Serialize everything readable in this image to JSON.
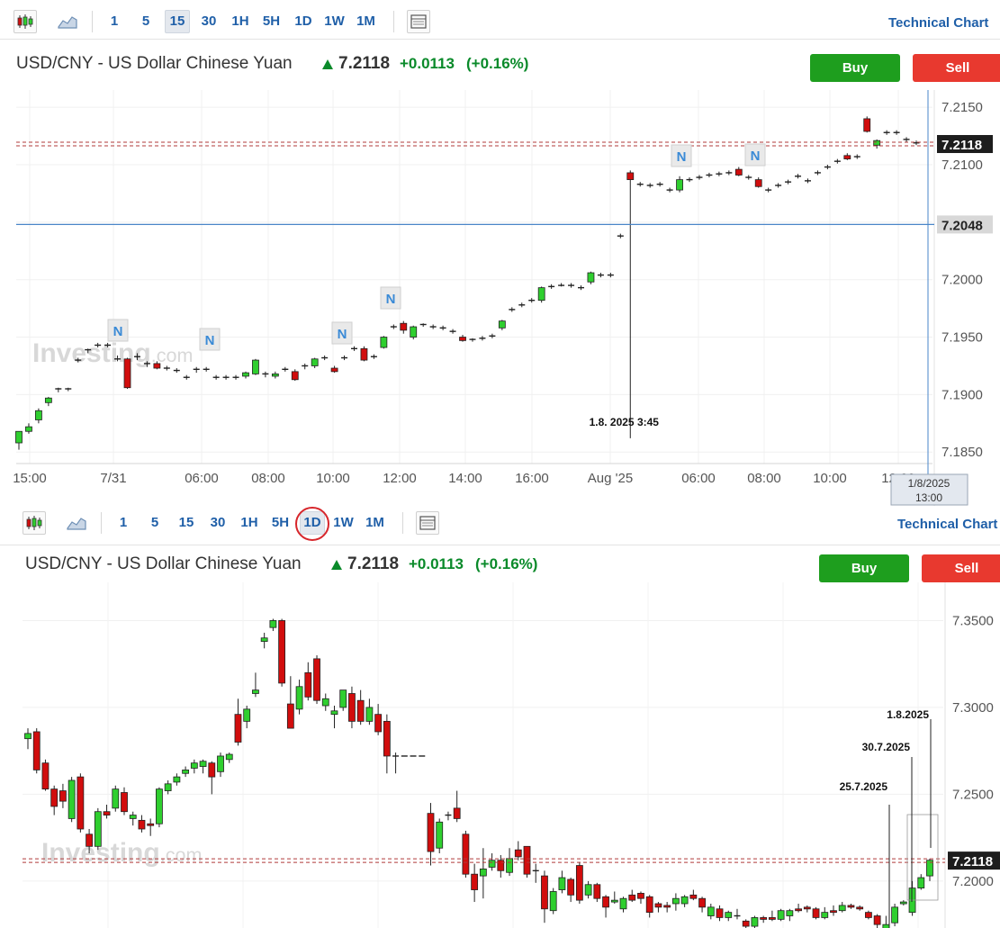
{
  "colors": {
    "up": "#2fcf2f",
    "down": "#d10d0d",
    "link": "#1f5fa8",
    "buy": "#1e9e1e",
    "sell": "#e8392f",
    "price_line": "#b03a3a",
    "crosshair": "#4a86c8",
    "change": "#0a8a2a"
  },
  "toolbar": {
    "timeframes": [
      "1",
      "5",
      "15",
      "30",
      "1H",
      "5H",
      "1D",
      "1W",
      "1M"
    ],
    "technical_chart": "Technical Chart",
    "icons": [
      "candlestick-icon",
      "area-chart-icon",
      "layout-icon"
    ]
  },
  "quote": {
    "name": "USD/CNY - US Dollar Chinese Yuan",
    "price": "7.2118",
    "change": "+0.0113",
    "change_pct": "(+0.16%)",
    "direction_icon": "up-arrow-icon"
  },
  "buttons": {
    "buy": "Buy",
    "sell": "Sell"
  },
  "watermark": {
    "brand": "Investing",
    "suffix": ".com"
  },
  "panel_top": {
    "active_timeframe": "15",
    "current_price_label": "7.2118",
    "crosshair_price_label": "7.2048",
    "crosshair_time_label_line1": "1/8/2025",
    "crosshair_time_label_line2": "13:00",
    "event_annotation": "1.8. 2025 3:45",
    "news_marker": "N"
  },
  "panel_bottom": {
    "active_timeframe": "1D",
    "current_price_label": "7.2118",
    "annotations": [
      "25.7.2025",
      "30.7.2025",
      "1.8.2025"
    ]
  },
  "chart_data": [
    {
      "type": "candlestick",
      "timeframe": "15 minutes",
      "x_tick_labels": [
        "15:00",
        "7/31",
        "06:00",
        "08:00",
        "10:00",
        "12:00",
        "14:00",
        "16:00",
        "Aug '25",
        "06:00",
        "08:00",
        "10:00",
        "12:00"
      ],
      "y_tick_labels": [
        "7.2150",
        "7.2100",
        "7.2050",
        "7.2000",
        "7.1950",
        "7.1900",
        "7.1850"
      ],
      "ylim": [
        7.184,
        7.2165
      ],
      "last_price": 7.2118,
      "crosshair_price": 7.2048,
      "annotation": "1.8. 2025 3:45",
      "candles": [
        [
          7.1858,
          7.1868,
          7.1852,
          7.1868
        ],
        [
          7.1868,
          7.1875,
          7.1866,
          7.1872
        ],
        [
          7.1878,
          7.1888,
          7.1875,
          7.1886
        ],
        [
          7.1893,
          7.1898,
          7.189,
          7.1897
        ],
        [
          7.1904,
          7.1906,
          7.1902,
          7.1905
        ],
        [
          7.1905,
          7.1906,
          7.1903,
          7.1905
        ],
        [
          7.193,
          7.1932,
          7.1928,
          7.193
        ],
        [
          7.1938,
          7.194,
          7.1936,
          7.1939
        ],
        [
          7.1943,
          7.1945,
          7.1941,
          7.1943
        ],
        [
          7.1943,
          7.1945,
          7.1941,
          7.1943
        ],
        [
          7.1931,
          7.1934,
          7.1929,
          7.1931
        ],
        [
          7.1931,
          7.1932,
          7.1905,
          7.1906
        ],
        [
          7.1932,
          7.1936,
          7.193,
          7.1933
        ],
        [
          7.1927,
          7.1929,
          7.1924,
          7.1927
        ],
        [
          7.1927,
          7.1929,
          7.1922,
          7.1923
        ],
        [
          7.1923,
          7.1925,
          7.1921,
          7.1923
        ],
        [
          7.1921,
          7.1923,
          7.1919,
          7.192
        ],
        [
          7.1915,
          7.1917,
          7.1913,
          7.1915
        ],
        [
          7.1921,
          7.1924,
          7.1919,
          7.1922
        ],
        [
          7.1922,
          7.1924,
          7.192,
          7.1922
        ],
        [
          7.1915,
          7.1917,
          7.1913,
          7.1915
        ],
        [
          7.1915,
          7.1917,
          7.1913,
          7.1915
        ],
        [
          7.1915,
          7.1917,
          7.1913,
          7.1914
        ],
        [
          7.1916,
          7.192,
          7.1914,
          7.1919
        ],
        [
          7.1918,
          7.1931,
          7.1917,
          7.193
        ],
        [
          7.1918,
          7.192,
          7.1915,
          7.1918
        ],
        [
          7.1916,
          7.192,
          7.1914,
          7.1918
        ],
        [
          7.1922,
          7.1924,
          7.192,
          7.1922
        ],
        [
          7.192,
          7.1922,
          7.1912,
          7.1913
        ],
        [
          7.1924,
          7.1927,
          7.1922,
          7.1925
        ],
        [
          7.1925,
          7.1932,
          7.1923,
          7.1931
        ],
        [
          7.1932,
          7.1934,
          7.193,
          7.1932
        ],
        [
          7.1923,
          7.1925,
          7.1919,
          7.192
        ],
        [
          7.1932,
          7.1934,
          7.193,
          7.1932
        ],
        [
          7.194,
          7.1942,
          7.1938,
          7.194
        ],
        [
          7.194,
          7.1942,
          7.1929,
          7.193
        ],
        [
          7.1933,
          7.1935,
          7.1931,
          7.1933
        ],
        [
          7.1941,
          7.1951,
          7.194,
          7.195
        ],
        [
          7.1959,
          7.1961,
          7.1957,
          7.1959
        ],
        [
          7.1962,
          7.1964,
          7.1953,
          7.1956
        ],
        [
          7.195,
          7.196,
          7.1948,
          7.1959
        ],
        [
          7.1961,
          7.1962,
          7.1959,
          7.1961
        ],
        [
          7.1959,
          7.1961,
          7.1957,
          7.1959
        ],
        [
          7.1958,
          7.196,
          7.1956,
          7.1958
        ],
        [
          7.1955,
          7.1957,
          7.1953,
          7.1955
        ],
        [
          7.195,
          7.1952,
          7.1946,
          7.1947
        ],
        [
          7.1948,
          7.1949,
          7.1946,
          7.1948
        ],
        [
          7.1949,
          7.1951,
          7.1947,
          7.1949
        ],
        [
          7.1951,
          7.1953,
          7.1949,
          7.1951
        ],
        [
          7.1958,
          7.1965,
          7.1956,
          7.1964
        ],
        [
          7.1974,
          7.1976,
          7.1972,
          7.1974
        ],
        [
          7.1978,
          7.198,
          7.1976,
          7.1978
        ],
        [
          7.1982,
          7.1984,
          7.198,
          7.1982
        ],
        [
          7.1982,
          7.1994,
          7.198,
          7.1993
        ],
        [
          7.1994,
          7.1996,
          7.1992,
          7.1994
        ],
        [
          7.1995,
          7.1997,
          7.1994,
          7.1995
        ],
        [
          7.1995,
          7.1997,
          7.1993,
          7.1994
        ],
        [
          7.1993,
          7.1995,
          7.1991,
          7.1993
        ],
        [
          7.1998,
          7.2007,
          7.1996,
          7.2006
        ],
        [
          7.2004,
          7.2006,
          7.2002,
          7.2004
        ],
        [
          7.2004,
          7.2006,
          7.2002,
          7.2004
        ],
        [
          7.2038,
          7.204,
          7.2036,
          7.2038
        ],
        [
          7.2093,
          7.2095,
          7.1862,
          7.2087
        ],
        [
          7.2083,
          7.2085,
          7.2081,
          7.2083
        ],
        [
          7.2082,
          7.2084,
          7.208,
          7.2082
        ],
        [
          7.2083,
          7.2085,
          7.2081,
          7.2083
        ],
        [
          7.2078,
          7.208,
          7.2076,
          7.2078
        ],
        [
          7.2078,
          7.209,
          7.2076,
          7.2087
        ],
        [
          7.2087,
          7.2089,
          7.2085,
          7.2087
        ],
        [
          7.2089,
          7.2091,
          7.2087,
          7.2089
        ],
        [
          7.2091,
          7.2093,
          7.2089,
          7.2091
        ],
        [
          7.2092,
          7.2094,
          7.209,
          7.2092
        ],
        [
          7.2093,
          7.2095,
          7.2091,
          7.2093
        ],
        [
          7.2096,
          7.2098,
          7.209,
          7.2091
        ],
        [
          7.2089,
          7.2091,
          7.2087,
          7.2089
        ],
        [
          7.2087,
          7.2089,
          7.208,
          7.2081
        ],
        [
          7.2078,
          7.208,
          7.2076,
          7.2077
        ],
        [
          7.2082,
          7.2084,
          7.208,
          7.2082
        ],
        [
          7.2085,
          7.2087,
          7.2083,
          7.2085
        ],
        [
          7.209,
          7.2092,
          7.2088,
          7.209
        ],
        [
          7.2086,
          7.2088,
          7.2084,
          7.2086
        ],
        [
          7.2093,
          7.2095,
          7.2091,
          7.2093
        ],
        [
          7.2098,
          7.21,
          7.2096,
          7.2098
        ],
        [
          7.2103,
          7.2105,
          7.2101,
          7.2103
        ],
        [
          7.2108,
          7.211,
          7.2104,
          7.2105
        ],
        [
          7.2107,
          7.2109,
          7.2105,
          7.2107
        ],
        [
          7.214,
          7.2142,
          7.2128,
          7.2129
        ],
        [
          7.2117,
          7.2122,
          7.2114,
          7.2121
        ],
        [
          7.2128,
          7.213,
          7.2126,
          7.2128
        ],
        [
          7.2128,
          7.213,
          7.2126,
          7.2128
        ],
        [
          7.2122,
          7.2124,
          7.212,
          7.2122
        ],
        [
          7.2119,
          7.2121,
          7.2117,
          7.2118
        ]
      ]
    },
    {
      "type": "candlestick",
      "timeframe": "daily",
      "y_tick_labels": [
        "7.3500",
        "7.3000",
        "7.2500",
        "7.2000"
      ],
      "ylim": [
        7.173,
        7.372
      ],
      "last_price": 7.2118,
      "annotations": [
        "25.7.2025",
        "30.7.2025",
        "1.8.2025"
      ],
      "candles": [
        [
          7.282,
          7.288,
          7.276,
          7.285
        ],
        [
          7.286,
          7.288,
          7.262,
          7.264
        ],
        [
          7.268,
          7.27,
          7.252,
          7.253
        ],
        [
          7.253,
          7.255,
          7.238,
          7.243
        ],
        [
          7.252,
          7.256,
          7.242,
          7.246
        ],
        [
          7.236,
          7.26,
          7.234,
          7.258
        ],
        [
          7.26,
          7.262,
          7.228,
          7.23
        ],
        [
          7.227,
          7.23,
          7.216,
          7.22
        ],
        [
          7.22,
          7.242,
          7.218,
          7.24
        ],
        [
          7.24,
          7.244,
          7.236,
          7.238
        ],
        [
          7.242,
          7.255,
          7.24,
          7.253
        ],
        [
          7.251,
          7.254,
          7.238,
          7.24
        ],
        [
          7.236,
          7.24,
          7.232,
          7.238
        ],
        [
          7.235,
          7.238,
          7.228,
          7.23
        ],
        [
          7.233,
          7.236,
          7.226,
          7.232
        ],
        [
          7.233,
          7.254,
          7.231,
          7.253
        ],
        [
          7.252,
          7.258,
          7.25,
          7.256
        ],
        [
          7.257,
          7.262,
          7.255,
          7.26
        ],
        [
          7.262,
          7.266,
          7.26,
          7.264
        ],
        [
          7.265,
          7.27,
          7.262,
          7.268
        ],
        [
          7.266,
          7.27,
          7.262,
          7.269
        ],
        [
          7.268,
          7.269,
          7.25,
          7.26
        ],
        [
          7.263,
          7.274,
          7.26,
          7.272
        ],
        [
          7.27,
          7.274,
          7.268,
          7.273
        ],
        [
          7.296,
          7.305,
          7.278,
          7.28
        ],
        [
          7.292,
          7.301,
          7.288,
          7.299
        ],
        [
          7.308,
          7.32,
          7.306,
          7.31
        ],
        [
          7.338,
          7.343,
          7.334,
          7.34
        ],
        [
          7.346,
          7.351,
          7.344,
          7.35
        ],
        [
          7.35,
          7.351,
          7.312,
          7.314
        ],
        [
          7.302,
          7.318,
          7.289,
          7.288
        ],
        [
          7.299,
          7.316,
          7.296,
          7.312
        ],
        [
          7.32,
          7.326,
          7.304,
          7.306
        ],
        [
          7.328,
          7.33,
          7.302,
          7.304
        ],
        [
          7.301,
          7.308,
          7.298,
          7.305
        ],
        [
          7.296,
          7.301,
          7.288,
          7.298
        ],
        [
          7.3,
          7.31,
          7.298,
          7.31
        ],
        [
          7.308,
          7.312,
          7.288,
          7.292
        ],
        [
          7.304,
          7.31,
          7.29,
          7.292
        ],
        [
          7.292,
          7.305,
          7.29,
          7.3
        ],
        [
          7.296,
          7.302,
          7.284,
          7.286
        ],
        [
          7.292,
          7.296,
          7.262,
          7.272
        ],
        [
          7.272,
          7.274,
          7.262,
          7.272
        ],
        [
          7.272,
          7.272,
          7.272,
          7.272
        ],
        [
          7.272,
          7.272,
          7.272,
          7.272
        ],
        [
          7.272,
          7.272,
          7.272,
          7.272
        ],
        [
          7.239,
          7.245,
          7.209,
          7.217
        ],
        [
          7.219,
          7.236,
          7.216,
          7.234
        ],
        [
          7.238,
          7.24,
          7.235,
          7.238
        ],
        [
          7.242,
          7.252,
          7.234,
          7.236
        ],
        [
          7.227,
          7.229,
          7.202,
          7.204
        ],
        [
          7.204,
          7.21,
          7.188,
          7.195
        ],
        [
          7.203,
          7.219,
          7.19,
          7.207
        ],
        [
          7.208,
          7.216,
          7.206,
          7.212
        ],
        [
          7.212,
          7.215,
          7.202,
          7.206
        ],
        [
          7.205,
          7.219,
          7.203,
          7.213
        ],
        [
          7.218,
          7.223,
          7.212,
          7.214
        ],
        [
          7.22,
          7.22,
          7.202,
          7.204
        ],
        [
          7.206,
          7.21,
          7.199,
          7.206
        ],
        [
          7.203,
          7.206,
          7.176,
          7.184
        ],
        [
          7.183,
          7.196,
          7.181,
          7.194
        ],
        [
          7.195,
          7.206,
          7.193,
          7.202
        ],
        [
          7.201,
          7.202,
          7.188,
          7.192
        ],
        [
          7.209,
          7.211,
          7.187,
          7.189
        ],
        [
          7.192,
          7.2,
          7.19,
          7.198
        ],
        [
          7.198,
          7.199,
          7.188,
          7.19
        ],
        [
          7.191,
          7.192,
          7.179,
          7.185
        ],
        [
          7.188,
          7.194,
          7.187,
          7.189
        ],
        [
          7.184,
          7.191,
          7.182,
          7.19
        ],
        [
          7.192,
          7.195,
          7.188,
          7.189
        ],
        [
          7.193,
          7.194,
          7.187,
          7.19
        ],
        [
          7.191,
          7.192,
          7.179,
          7.182
        ],
        [
          7.187,
          7.188,
          7.182,
          7.185
        ],
        [
          7.186,
          7.188,
          7.182,
          7.185
        ],
        [
          7.187,
          7.193,
          7.183,
          7.19
        ],
        [
          7.187,
          7.192,
          7.185,
          7.191
        ],
        [
          7.192,
          7.195,
          7.189,
          7.19
        ],
        [
          7.19,
          7.191,
          7.182,
          7.185
        ],
        [
          7.18,
          7.187,
          7.178,
          7.185
        ],
        [
          7.184,
          7.186,
          7.177,
          7.179
        ],
        [
          7.179,
          7.183,
          7.177,
          7.182
        ],
        [
          7.18,
          7.184,
          7.178,
          7.18
        ],
        [
          7.177,
          7.178,
          7.172,
          7.174
        ],
        [
          7.174,
          7.18,
          7.173,
          7.179
        ],
        [
          7.179,
          7.18,
          7.176,
          7.178
        ],
        [
          7.179,
          7.183,
          7.177,
          7.178
        ],
        [
          7.178,
          7.184,
          7.177,
          7.183
        ],
        [
          7.18,
          7.184,
          7.177,
          7.183
        ],
        [
          7.184,
          7.187,
          7.182,
          7.183
        ],
        [
          7.185,
          7.186,
          7.182,
          7.184
        ],
        [
          7.184,
          7.185,
          7.178,
          7.179
        ],
        [
          7.179,
          7.185,
          7.178,
          7.182
        ],
        [
          7.183,
          7.186,
          7.18,
          7.182
        ],
        [
          7.183,
          7.188,
          7.182,
          7.186
        ],
        [
          7.186,
          7.187,
          7.184,
          7.185
        ],
        [
          7.185,
          7.186,
          7.183,
          7.184
        ],
        [
          7.182,
          7.183,
          7.178,
          7.179
        ],
        [
          7.18,
          7.181,
          7.173,
          7.175
        ],
        [
          7.171,
          7.18,
          7.169,
          7.175
        ],
        [
          7.176,
          7.187,
          7.174,
          7.185
        ],
        [
          7.187,
          7.189,
          7.186,
          7.188
        ],
        [
          7.182,
          7.2,
          7.18,
          7.196
        ],
        [
          7.196,
          7.204,
          7.195,
          7.202
        ],
        [
          7.203,
          7.213,
          7.2,
          7.212
        ]
      ]
    }
  ]
}
